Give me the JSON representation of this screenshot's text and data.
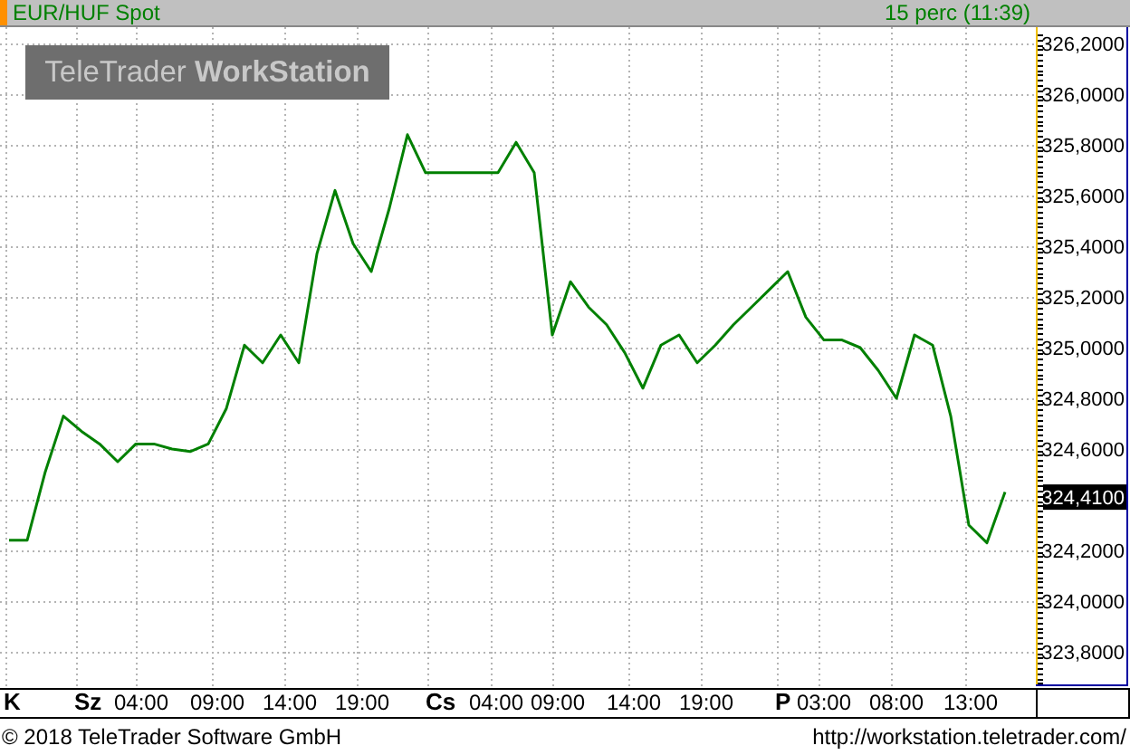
{
  "header": {
    "title": "EUR/HUF Spot",
    "interval": "15 perc (11:39)"
  },
  "logo": "TeleTrader **WorkStation**",
  "chart": {
    "price_axis": [
      "326,2000",
      "326,0000",
      "325,8000",
      "325,6000",
      "325,4000",
      "325,2000",
      "325,0000",
      "324,8000",
      "324,6000",
      "324,2000",
      "324,0000",
      "323,8000"
    ],
    "last_price": "324,4100",
    "time_axis": [
      {
        "text": "K",
        "kind": "day"
      },
      {
        "text": "Sz",
        "kind": "day"
      },
      {
        "text": "04:00",
        "kind": "time"
      },
      {
        "text": "09:00",
        "kind": "time"
      },
      {
        "text": "14:00",
        "kind": "time"
      },
      {
        "text": "19:00",
        "kind": "time"
      },
      {
        "text": "Cs",
        "kind": "day"
      },
      {
        "text": "04:00",
        "kind": "time"
      },
      {
        "text": "09:00",
        "kind": "time"
      },
      {
        "text": "14:00",
        "kind": "time"
      },
      {
        "text": "19:00",
        "kind": "time"
      },
      {
        "text": "P",
        "kind": "day"
      },
      {
        "text": "03:00",
        "kind": "time"
      },
      {
        "text": "08:00",
        "kind": "time"
      },
      {
        "text": "13:00",
        "kind": "time"
      }
    ]
  },
  "footer": {
    "copyright": "© 2018 TeleTrader Software GmbH",
    "url": "http://workstation.teletrader.com/"
  }
}
